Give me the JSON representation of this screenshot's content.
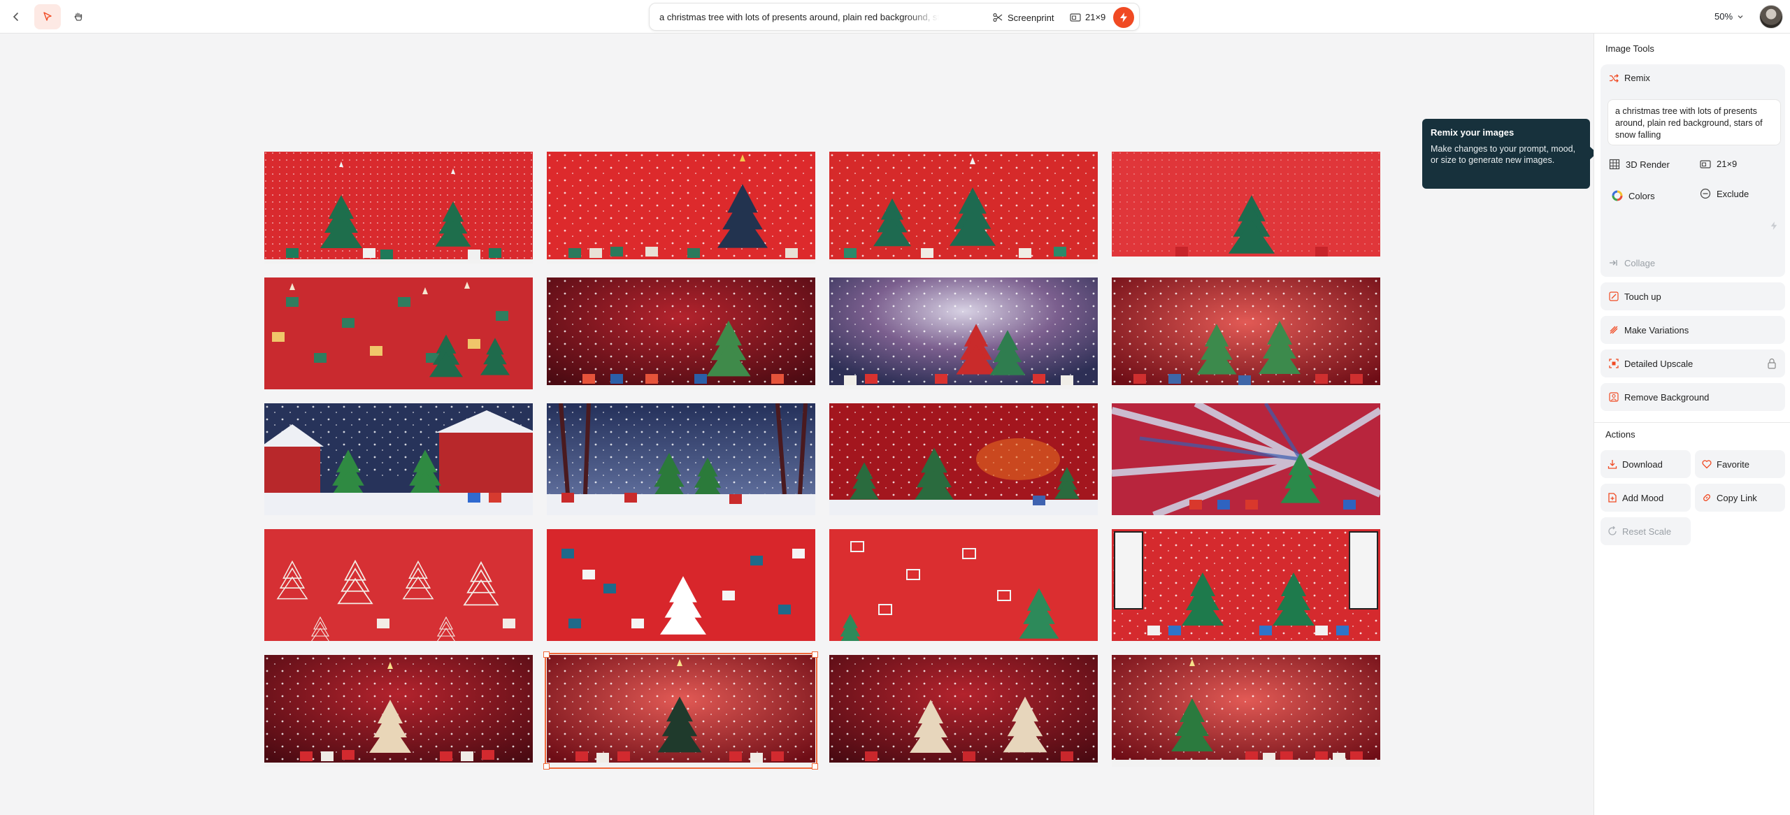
{
  "toolbar": {
    "prompt": "a christmas tree with lots of presents around, plain red background, stars of snow falling",
    "style": "Screenprint",
    "aspect": "21×9",
    "zoom": "50%"
  },
  "tooltip": {
    "title": "Remix your images",
    "body": "Make changes to your prompt, mood, or size to generate new images."
  },
  "panel": {
    "image_tools_title": "Image Tools",
    "remix_label": "Remix",
    "remix_prompt": "a christmas tree with lots of presents around, plain red background, stars of snow falling",
    "render_label": "3D Render",
    "aspect_label": "21×9",
    "colors_label": "Colors",
    "exclude_label": "Exclude",
    "tools": [
      {
        "label": "Collage",
        "disabled": true
      },
      {
        "label": "Touch up"
      },
      {
        "label": "Make Variations"
      },
      {
        "label": "Detailed Upscale"
      },
      {
        "label": "Remove Background"
      }
    ],
    "actions_title": "Actions",
    "actions": {
      "download": "Download",
      "favorite": "Favorite",
      "add_mood": "Add Mood",
      "copy_link": "Copy Link",
      "reset_scale": "Reset Scale"
    }
  },
  "colors": {
    "accent": "#f04a23",
    "tooltip_bg": "#17313c",
    "selection": "#f0683a"
  },
  "gallery": {
    "rows": 5,
    "cols": 4,
    "selected_index": 17,
    "themes": [
      "pattern-trees",
      "red-tree-presents",
      "red-trees-presents",
      "red-single-tree",
      "pattern-gifts",
      "red-night-tree",
      "blue-sky-trees",
      "red-sparkle-trees",
      "blue-night-houses",
      "blue-forest",
      "red-watercolor",
      "radial-burst",
      "pattern-white-trees",
      "pattern-gift-boxes",
      "pattern-red-gifts",
      "window-scene",
      "dark-red-tree",
      "red-glow-tree",
      "dark-red-two-trees",
      "red-snow-tree"
    ]
  }
}
